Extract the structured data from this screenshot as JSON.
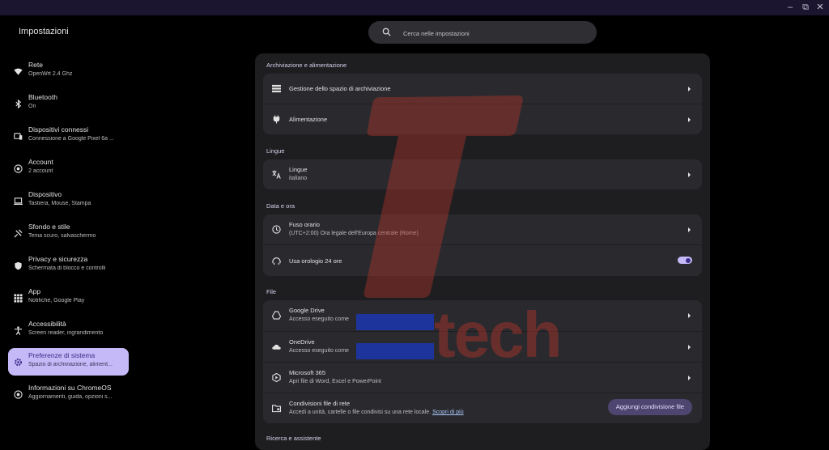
{
  "window": {
    "controls": {
      "minimize": "–",
      "restore": "⧉",
      "close": "✕"
    }
  },
  "app": {
    "title": "Impostazioni"
  },
  "search": {
    "placeholder": "Cerca nelle impostazioni",
    "icon": "search-icon"
  },
  "sidebar": {
    "items": [
      {
        "title": "Rete",
        "subtitle": "OpenWrt 2.4 Ghz",
        "icon": "wifi-icon",
        "active": false
      },
      {
        "title": "Bluetooth",
        "subtitle": "On",
        "icon": "bluetooth-icon",
        "active": false
      },
      {
        "title": "Dispositivi connessi",
        "subtitle": "Connessione a Google Pixel 6a ...",
        "icon": "devices-icon",
        "active": false
      },
      {
        "title": "Account",
        "subtitle": "2 account",
        "icon": "account-icon",
        "active": false
      },
      {
        "title": "Dispositivo",
        "subtitle": "Tastiera, Mouse, Stampa",
        "icon": "laptop-icon",
        "active": false
      },
      {
        "title": "Sfondo e stile",
        "subtitle": "Tema scuro, salvaschermo",
        "icon": "palette-icon",
        "active": false
      },
      {
        "title": "Privacy e sicurezza",
        "subtitle": "Schermata di blocco e controlli",
        "icon": "shield-icon",
        "active": false
      },
      {
        "title": "App",
        "subtitle": "Notifiche, Google Play",
        "icon": "apps-grid-icon",
        "active": false
      },
      {
        "title": "Accessibilità",
        "subtitle": "Screen reader, ingrandimento",
        "icon": "accessibility-icon",
        "active": false
      },
      {
        "title": "Preferenze di sistema",
        "subtitle": "Spazio di archiviazione, aliment...",
        "icon": "gear-icon",
        "active": true
      },
      {
        "title": "Informazioni su ChromeOS",
        "subtitle": "Aggiornamenti, guida, opzioni s...",
        "icon": "chromeos-icon",
        "active": false
      }
    ]
  },
  "main": {
    "storage": {
      "heading": "Archiviazione e alimentazione",
      "rows": [
        {
          "title": "Gestione dello spazio di archiviazione",
          "icon": "storage-icon"
        },
        {
          "title": "Alimentazione",
          "icon": "power-plug-icon"
        }
      ]
    },
    "languages": {
      "heading": "Lingue",
      "rows": [
        {
          "title": "Lingue",
          "subtitle": "italiano",
          "icon": "translate-icon"
        }
      ]
    },
    "datetime": {
      "heading": "Data e ora",
      "rows": [
        {
          "title": "Fuso orario",
          "subtitle": "(UTC+2:00) Ora legale dell'Europa centrale (Rome)",
          "icon": "clock-icon"
        },
        {
          "title": "Usa orologio 24 ore",
          "icon": "clock-24-icon",
          "toggle_on": true
        }
      ]
    },
    "files": {
      "heading": "File",
      "rows": [
        {
          "title": "Google Drive",
          "subtitle": "Accesso eseguito come",
          "icon": "google-drive-icon"
        },
        {
          "title": "OneDrive",
          "subtitle": "Accesso eseguito come",
          "icon": "onedrive-icon"
        },
        {
          "title": "Microsoft 365",
          "subtitle": "Apri file di Word, Excel e PowerPoint",
          "icon": "microsoft-365-icon"
        },
        {
          "title": "Condivisioni file di rete",
          "subtitle": "Accedi a unità, cartelle o file condivisi su una rete locale.",
          "link": "Scopri di più",
          "icon": "network-folder-icon",
          "button": "Aggiungi condivisione file"
        }
      ]
    },
    "search_assistant": {
      "heading": "Ricerca e assistente"
    }
  },
  "watermark": {
    "text": "tech",
    "color": "#b3342b"
  },
  "colors": {
    "accent": "#c6b9f8",
    "background": "#000000",
    "card": "#2a2a2e",
    "panel": "#1e1e21"
  }
}
